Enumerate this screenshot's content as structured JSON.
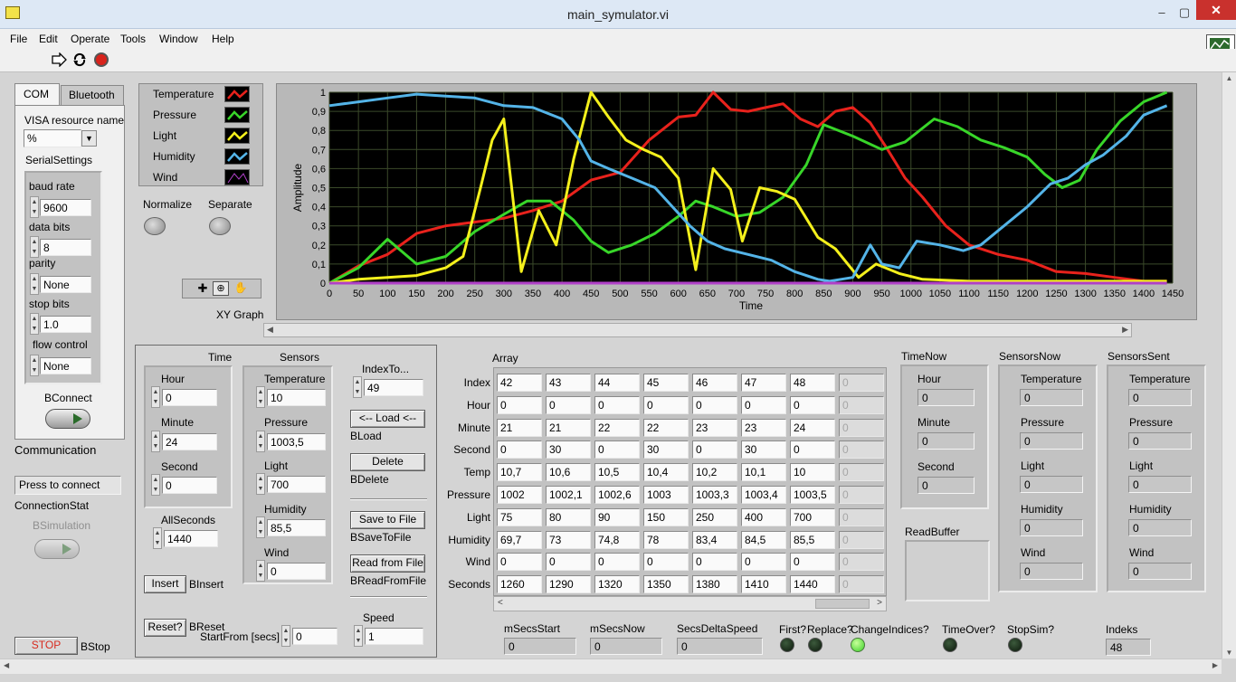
{
  "window": {
    "title": "main_symulator.vi",
    "minimize": "‒",
    "maximize": "▢",
    "close": "✕"
  },
  "menu": [
    "File",
    "Edit",
    "Operate",
    "Tools",
    "Window",
    "Help"
  ],
  "tabs": [
    "COM",
    "Bluetooth"
  ],
  "com": {
    "visa_label": "VISA resource name",
    "visa_value": "%",
    "serial_label": "SerialSettings",
    "baud_label": "baud rate",
    "baud_value": "9600",
    "data_bits_label": "data bits",
    "data_bits_value": "8",
    "parity_label": "parity",
    "parity_value": "None",
    "stop_bits_label": "stop bits",
    "stop_bits_value": "1.0",
    "flow_label": "flow control",
    "flow_value": "None",
    "bconnect_label": "BConnect",
    "communication_label": "Communication",
    "press_connect": "Press to connect",
    "connection_stat_label": "ConnectionStat",
    "bsimulation_label": "BSimulation",
    "stop_button": "STOP",
    "bstop_label": "BStop"
  },
  "legend": [
    {
      "name": "Temperature",
      "color": "#e8221c"
    },
    {
      "name": "Pressure",
      "color": "#38d629"
    },
    {
      "name": "Light",
      "color": "#f4f01c"
    },
    {
      "name": "Humidity",
      "color": "#54b4e8"
    },
    {
      "name": "Wind",
      "color": "#b040c8"
    }
  ],
  "normalize_label": "Normalize",
  "separate_label": "Separate",
  "graph_name": "XY Graph",
  "chart_data": {
    "type": "line",
    "xlabel": "Time",
    "ylabel": "Amplitude",
    "xlim": [
      0,
      1450
    ],
    "ylim": [
      0,
      1
    ],
    "xticks": [
      0,
      50,
      100,
      150,
      200,
      250,
      300,
      350,
      400,
      450,
      500,
      550,
      600,
      650,
      700,
      750,
      800,
      850,
      900,
      950,
      1000,
      1050,
      1100,
      1150,
      1200,
      1250,
      1300,
      1350,
      1400,
      1450
    ],
    "yticks": [
      "0",
      "0,1",
      "0,2",
      "0,3",
      "0,4",
      "0,5",
      "0,6",
      "0,7",
      "0,8",
      "0,9",
      "1"
    ],
    "grid": true,
    "series": [
      {
        "name": "Temperature",
        "color": "#e8221c",
        "points": [
          [
            0,
            0
          ],
          [
            50,
            0.09
          ],
          [
            100,
            0.15
          ],
          [
            150,
            0.26
          ],
          [
            200,
            0.3
          ],
          [
            250,
            0.32
          ],
          [
            300,
            0.34
          ],
          [
            350,
            0.38
          ],
          [
            400,
            0.43
          ],
          [
            450,
            0.54
          ],
          [
            500,
            0.58
          ],
          [
            550,
            0.75
          ],
          [
            600,
            0.87
          ],
          [
            630,
            0.88
          ],
          [
            660,
            1.0
          ],
          [
            690,
            0.91
          ],
          [
            720,
            0.9
          ],
          [
            750,
            0.92
          ],
          [
            780,
            0.94
          ],
          [
            810,
            0.86
          ],
          [
            840,
            0.82
          ],
          [
            870,
            0.9
          ],
          [
            900,
            0.92
          ],
          [
            930,
            0.84
          ],
          [
            960,
            0.7
          ],
          [
            990,
            0.55
          ],
          [
            1020,
            0.45
          ],
          [
            1060,
            0.3
          ],
          [
            1100,
            0.2
          ],
          [
            1150,
            0.15
          ],
          [
            1200,
            0.12
          ],
          [
            1250,
            0.06
          ],
          [
            1300,
            0.05
          ],
          [
            1350,
            0.03
          ],
          [
            1400,
            0.01
          ],
          [
            1440,
            0.01
          ]
        ]
      },
      {
        "name": "Pressure",
        "color": "#38d629",
        "points": [
          [
            0,
            0
          ],
          [
            50,
            0.08
          ],
          [
            100,
            0.23
          ],
          [
            150,
            0.1
          ],
          [
            200,
            0.14
          ],
          [
            250,
            0.27
          ],
          [
            300,
            0.36
          ],
          [
            340,
            0.43
          ],
          [
            380,
            0.43
          ],
          [
            420,
            0.33
          ],
          [
            450,
            0.22
          ],
          [
            480,
            0.16
          ],
          [
            520,
            0.2
          ],
          [
            560,
            0.26
          ],
          [
            600,
            0.35
          ],
          [
            630,
            0.43
          ],
          [
            660,
            0.4
          ],
          [
            700,
            0.35
          ],
          [
            740,
            0.37
          ],
          [
            780,
            0.45
          ],
          [
            820,
            0.62
          ],
          [
            850,
            0.83
          ],
          [
            900,
            0.77
          ],
          [
            950,
            0.7
          ],
          [
            990,
            0.74
          ],
          [
            1040,
            0.86
          ],
          [
            1080,
            0.82
          ],
          [
            1120,
            0.75
          ],
          [
            1160,
            0.71
          ],
          [
            1200,
            0.66
          ],
          [
            1230,
            0.57
          ],
          [
            1260,
            0.5
          ],
          [
            1290,
            0.54
          ],
          [
            1320,
            0.7
          ],
          [
            1360,
            0.85
          ],
          [
            1400,
            0.95
          ],
          [
            1440,
            1.0
          ]
        ]
      },
      {
        "name": "Light",
        "color": "#f4f01c",
        "points": [
          [
            0,
            0
          ],
          [
            50,
            0.02
          ],
          [
            100,
            0.03
          ],
          [
            150,
            0.04
          ],
          [
            200,
            0.08
          ],
          [
            230,
            0.14
          ],
          [
            260,
            0.5
          ],
          [
            280,
            0.75
          ],
          [
            300,
            0.86
          ],
          [
            330,
            0.06
          ],
          [
            360,
            0.38
          ],
          [
            390,
            0.2
          ],
          [
            420,
            0.65
          ],
          [
            450,
            1.0
          ],
          [
            480,
            0.87
          ],
          [
            510,
            0.75
          ],
          [
            540,
            0.7
          ],
          [
            570,
            0.66
          ],
          [
            600,
            0.55
          ],
          [
            630,
            0.07
          ],
          [
            660,
            0.6
          ],
          [
            690,
            0.49
          ],
          [
            710,
            0.22
          ],
          [
            740,
            0.5
          ],
          [
            770,
            0.48
          ],
          [
            800,
            0.44
          ],
          [
            840,
            0.24
          ],
          [
            870,
            0.18
          ],
          [
            910,
            0.03
          ],
          [
            940,
            0.1
          ],
          [
            980,
            0.05
          ],
          [
            1020,
            0.02
          ],
          [
            1100,
            0.01
          ],
          [
            1300,
            0.01
          ],
          [
            1440,
            0.01
          ]
        ]
      },
      {
        "name": "Humidity",
        "color": "#54b4e8",
        "points": [
          [
            0,
            0.93
          ],
          [
            50,
            0.95
          ],
          [
            100,
            0.97
          ],
          [
            150,
            0.99
          ],
          [
            200,
            0.98
          ],
          [
            250,
            0.97
          ],
          [
            300,
            0.93
          ],
          [
            350,
            0.92
          ],
          [
            400,
            0.86
          ],
          [
            430,
            0.75
          ],
          [
            450,
            0.64
          ],
          [
            480,
            0.6
          ],
          [
            520,
            0.55
          ],
          [
            560,
            0.5
          ],
          [
            590,
            0.4
          ],
          [
            620,
            0.3
          ],
          [
            650,
            0.22
          ],
          [
            680,
            0.18
          ],
          [
            720,
            0.15
          ],
          [
            760,
            0.12
          ],
          [
            800,
            0.06
          ],
          [
            840,
            0.02
          ],
          [
            860,
            0.01
          ],
          [
            900,
            0.03
          ],
          [
            930,
            0.2
          ],
          [
            950,
            0.1
          ],
          [
            980,
            0.08
          ],
          [
            1010,
            0.22
          ],
          [
            1050,
            0.2
          ],
          [
            1090,
            0.17
          ],
          [
            1120,
            0.2
          ],
          [
            1160,
            0.3
          ],
          [
            1200,
            0.4
          ],
          [
            1240,
            0.52
          ],
          [
            1270,
            0.55
          ],
          [
            1300,
            0.62
          ],
          [
            1330,
            0.67
          ],
          [
            1370,
            0.77
          ],
          [
            1400,
            0.88
          ],
          [
            1440,
            0.93
          ]
        ]
      },
      {
        "name": "Wind",
        "color": "#b040c8",
        "points": [
          [
            0,
            0
          ],
          [
            1440,
            0
          ]
        ]
      }
    ]
  },
  "time_box": {
    "title": "Time",
    "hour_label": "Hour",
    "hour_value": "0",
    "minute_label": "Minute",
    "minute_value": "24",
    "second_label": "Second",
    "second_value": "0",
    "allseconds_label": "AllSeconds",
    "allseconds_value": "1440"
  },
  "sensors_box": {
    "title": "Sensors",
    "temp_label": "Temperature",
    "temp_value": "10",
    "pressure_label": "Pressure",
    "pressure_value": "1003,5",
    "light_label": "Light",
    "light_value": "700",
    "humidity_label": "Humidity",
    "humidity_value": "85,5",
    "wind_label": "Wind",
    "wind_value": "0"
  },
  "buttons": {
    "indexto_label": "IndexTo...",
    "indexto_value": "49",
    "load": "<-- Load <--",
    "bload": "BLoad",
    "delete": "Delete",
    "bdelete": "BDelete",
    "save": "Save to File",
    "bsave": "BSaveToFile",
    "read": "Read from File",
    "bread": "BReadFromFile",
    "insert": "Insert",
    "binsert": "BInsert",
    "reset": "Reset?",
    "breset": "BReset",
    "startfrom_label": "StartFrom [secs]",
    "startfrom_value": "0",
    "speed_label": "Speed",
    "speed_value": "1"
  },
  "array": {
    "title": "Array",
    "rows": [
      {
        "label": "Index",
        "values": [
          "42",
          "43",
          "44",
          "45",
          "46",
          "47",
          "48",
          "0"
        ]
      },
      {
        "label": "Hour",
        "values": [
          "0",
          "0",
          "0",
          "0",
          "0",
          "0",
          "0",
          "0"
        ]
      },
      {
        "label": "Minute",
        "values": [
          "21",
          "21",
          "22",
          "22",
          "23",
          "23",
          "24",
          "0"
        ]
      },
      {
        "label": "Second",
        "values": [
          "0",
          "30",
          "0",
          "30",
          "0",
          "30",
          "0",
          "0"
        ]
      },
      {
        "label": "Temp",
        "values": [
          "10,7",
          "10,6",
          "10,5",
          "10,4",
          "10,2",
          "10,1",
          "10",
          "0"
        ]
      },
      {
        "label": "Pressure",
        "values": [
          "1002",
          "1002,1",
          "1002,6",
          "1003",
          "1003,3",
          "1003,4",
          "1003,5",
          "0"
        ]
      },
      {
        "label": "Light",
        "values": [
          "75",
          "80",
          "90",
          "150",
          "250",
          "400",
          "700",
          "0"
        ]
      },
      {
        "label": "Humidity",
        "values": [
          "69,7",
          "73",
          "74,8",
          "78",
          "83,4",
          "84,5",
          "85,5",
          "0"
        ]
      },
      {
        "label": "Wind",
        "values": [
          "0",
          "0",
          "0",
          "0",
          "0",
          "0",
          "0",
          "0"
        ]
      },
      {
        "label": "Seconds",
        "values": [
          "1260",
          "1290",
          "1320",
          "1350",
          "1380",
          "1410",
          "1440",
          "0"
        ]
      }
    ]
  },
  "timenow": {
    "title": "TimeNow",
    "hour_label": "Hour",
    "hour_value": "0",
    "minute_label": "Minute",
    "minute_value": "0",
    "second_label": "Second",
    "second_value": "0",
    "readbuffer_label": "ReadBuffer"
  },
  "sensorsnow": {
    "title": "SensorsNow",
    "temp_label": "Temperature",
    "temp_value": "0",
    "pressure_label": "Pressure",
    "pressure_value": "0",
    "light_label": "Light",
    "light_value": "0",
    "humidity_label": "Humidity",
    "humidity_value": "0",
    "wind_label": "Wind",
    "wind_value": "0"
  },
  "sensorssent": {
    "title": "SensorsSent",
    "temp_label": "Temperature",
    "temp_value": "0",
    "pressure_label": "Pressure",
    "pressure_value": "0",
    "light_label": "Light",
    "light_value": "0",
    "humidity_label": "Humidity",
    "humidity_value": "0",
    "wind_label": "Wind",
    "wind_value": "0"
  },
  "bottom": {
    "msecsstart_label": "mSecsStart",
    "msecsstart_value": "0",
    "msecsnow_label": "mSecsNow",
    "msecsnow_value": "0",
    "secsdelta_label": "SecsDeltaSpeed",
    "secsdelta_value": "0",
    "first_label": "First?",
    "replace_label": "Replace?",
    "change_label": "ChangeIndices?",
    "timeover_label": "TimeOver?",
    "stopsim_label": "StopSim?",
    "indeks_label": "Indeks",
    "indeks_value": "48"
  }
}
